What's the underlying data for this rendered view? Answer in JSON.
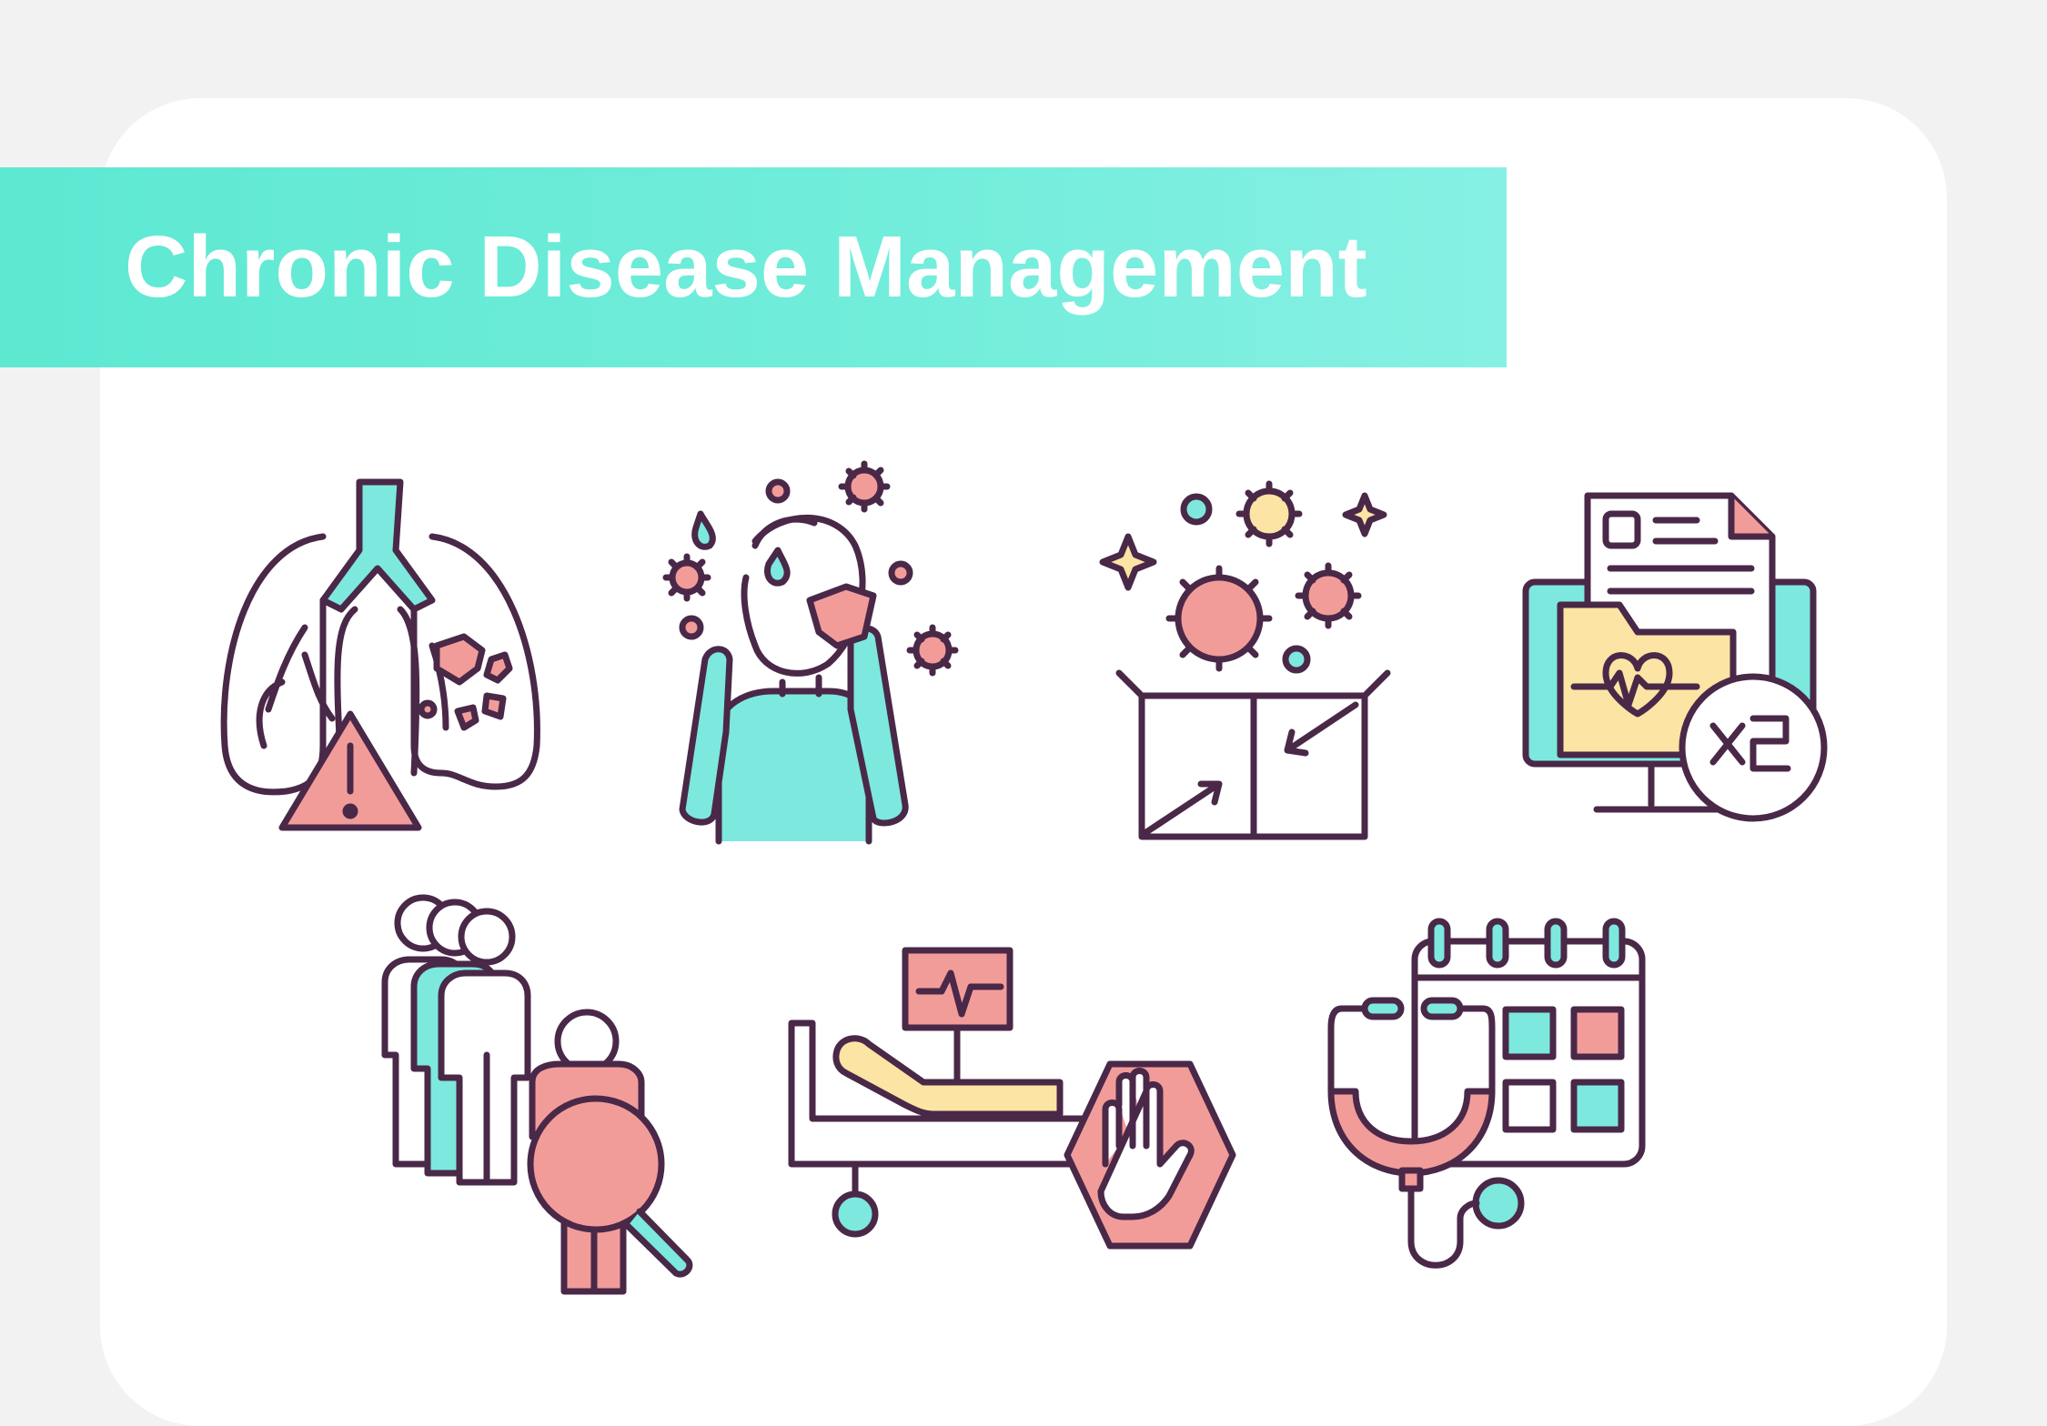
{
  "banner": {
    "title": "Chronic Disease Management"
  },
  "palette": {
    "outline": "#4a2848",
    "teal": "#7de8de",
    "pink": "#f29c9a",
    "yellow": "#fbe4a4",
    "banner_start": "#5de8d2",
    "banner_end": "#86f0e4",
    "card": "#ffffff",
    "background": "#f2f2f2"
  },
  "icons": [
    {
      "name": "lungs-warning-icon"
    },
    {
      "name": "person-crying-viruses-icon"
    },
    {
      "name": "box-viruses-icon"
    },
    {
      "name": "medical-records-monitor-icon"
    },
    {
      "name": "people-search-icon"
    },
    {
      "name": "hospital-bed-stop-icon"
    },
    {
      "name": "stethoscope-calendar-icon"
    }
  ],
  "multiplier_badge": "×2"
}
